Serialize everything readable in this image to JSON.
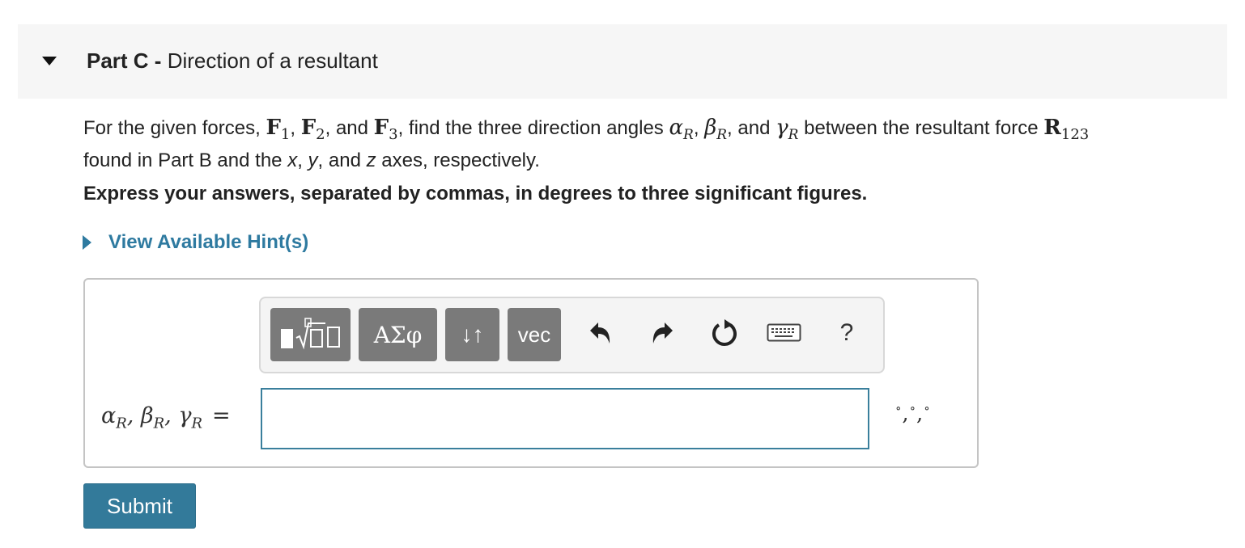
{
  "part": {
    "label": "Part C",
    "separator": " - ",
    "title": "Direction of a resultant"
  },
  "question": {
    "t1": "For the given forces, ",
    "F": "F",
    "s1": "1",
    "s2": "2",
    "s3": "3",
    "comma": ", ",
    "and": ", and ",
    "t2": ", find the three direction angles ",
    "alpha": "α",
    "beta": "β",
    "gamma": "γ",
    "R": "R",
    "t3": ", and ",
    "t4": " between the resultant force ",
    "Rbold": "R",
    "r123": "123",
    "t5": " found in Part B and the ",
    "x": "x",
    "t6": ", ",
    "y": "y",
    "t7": ", and ",
    "z": "z",
    "t8": " axes, respectively."
  },
  "instruction": "Express your answers, separated by commas, in degrees to three significant figures.",
  "hint": {
    "label": "View Available Hint(s)"
  },
  "toolbar": {
    "greek_label": "ΑΣφ",
    "arrows_label": "↓↑",
    "vec_label": "vec",
    "help_label": "?"
  },
  "answer": {
    "alpha": "α",
    "beta": "β",
    "gamma": "γ",
    "R": "R",
    "sep": ", ",
    "equals": "=",
    "value": "",
    "units": {
      "deg": "∘",
      "comma": ","
    }
  },
  "submit_label": "Submit",
  "colors": {
    "accent": "#2e7aa0",
    "button_gray": "#7a7a7a",
    "submit": "#337a9a"
  }
}
